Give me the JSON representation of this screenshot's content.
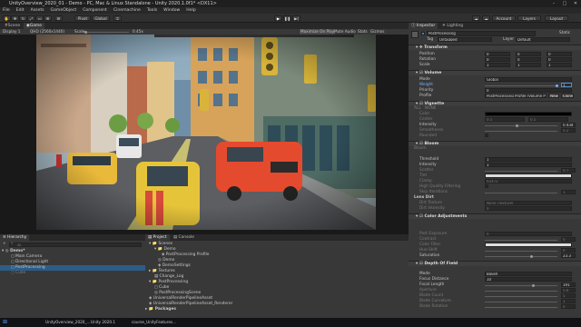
{
  "window": {
    "title": "UnityOverview_2020_01 - Demo - PC, Mac & Linux Standalone - Unity 2020.1.0f1* <DX11>"
  },
  "menu": [
    "File",
    "Edit",
    "Assets",
    "GameObject",
    "Component",
    "Cinemachine",
    "Tools",
    "Window",
    "Help"
  ],
  "toolbar": {
    "pivot": "Pivot",
    "global": "Global",
    "account": "Account",
    "layers": "Layers",
    "layout": "Layout"
  },
  "game": {
    "tabs": {
      "scene": "Scene",
      "game": "Game"
    },
    "display": "Display 1",
    "resolution": "QHD (2560x1440)",
    "scale_label": "Scale",
    "scale_value": "0.45x",
    "maximize": "Maximize On Play",
    "mute": "Mute Audio",
    "stats": "Stats",
    "gizmos": "Gizmos"
  },
  "hierarchy": {
    "tab": "Hierarchy",
    "add": "+",
    "search_placeholder": "All",
    "items": [
      {
        "label": "Demo*",
        "dim": false,
        "bold": true
      },
      {
        "label": "Main Camera",
        "dim": false,
        "bold": false
      },
      {
        "label": "Directional Light",
        "dim": false,
        "bold": false
      },
      {
        "label": "PostProcessing",
        "dim": false,
        "bold": false
      },
      {
        "label": "Cube",
        "dim": true,
        "bold": false
      }
    ]
  },
  "project": {
    "tab": "Project",
    "tab2": "Console",
    "items": [
      "Scenes",
      "Demo",
      "PostProcessing Profile",
      "Demo",
      "DemoSettings",
      "Textures",
      "Change_Log",
      "PostProcessing",
      "Cube",
      "PostProcessingScene",
      "UniversalRenderPipelineAsset",
      "UniversalRenderPipelineAsset_Renderer",
      "Packages"
    ]
  },
  "inspector": {
    "tab": "Inspector",
    "tab2": "Lighting",
    "object_name": "PostProcessing",
    "static": "Static",
    "tag_label": "Tag",
    "tag": "Untagged",
    "layer_label": "Layer",
    "layer": "Default",
    "transform": {
      "title": "Transform",
      "position": "Position",
      "rotation": "Rotation",
      "scale": "Scale",
      "pos": [
        "0",
        "0",
        "0"
      ],
      "rot": [
        "0",
        "0",
        "0"
      ],
      "scl": [
        "1",
        "1",
        "1"
      ]
    },
    "volume": {
      "title": "Volume",
      "mode_label": "Mode",
      "mode": "Global",
      "weight_label": "Weight",
      "weight": "1",
      "priority_label": "Priority",
      "priority": "0",
      "profile_label": "Profile",
      "profile": "PostProcessing Profile (Volume Profile)",
      "new": "New",
      "clone": "Clone"
    },
    "vignette": {
      "title": "Vignette",
      "all": "ALL",
      "none": "NONE",
      "color": "Color",
      "center": "Center",
      "center_x": "0.5",
      "center_y": "0.5",
      "intensity": "Intensity",
      "intensity_value": "0.434",
      "smoothness": "Smoothness",
      "smoothness_value": "0.2",
      "rounded": "Rounded"
    },
    "bloom": {
      "title": "Bloom",
      "section": "Bloom",
      "threshold": "Threshold",
      "threshold_value": "1",
      "intensity": "Intensity",
      "intensity_value": "1",
      "scatter": "Scatter",
      "scatter_value": "0.7",
      "tint": "Tint",
      "clamp": "Clamp",
      "clamp_value": "65472",
      "hq": "High Quality Filtering",
      "skip": "Skip Iterations",
      "skip_value": "1",
      "lens_dirt": "Lens Dirt",
      "dirt_texture": "Dirt Texture",
      "dirt_texture_value": "None (Texture)",
      "dirt_intensity": "Dirt Intensity",
      "dirt_intensity_value": "0"
    },
    "color_adj": {
      "title": "Color Adjustments",
      "post_exposure": "Post Exposure",
      "post_exposure_value": "0",
      "contrast": "Contrast",
      "contrast_value": "0",
      "color_filter": "Color Filter",
      "hue_shift": "Hue Shift",
      "hue_shift_value": "0",
      "saturation": "Saturation",
      "saturation_value": "23.3"
    },
    "dof": {
      "title": "Depth Of Field",
      "mode": "Mode",
      "mode_value": "Bokeh",
      "focus": "Focus Distance",
      "focus_value": "10",
      "focal": "Focal Length",
      "focal_value": "191",
      "aperture": "Aperture",
      "aperture_value": "5.6",
      "blade_count": "Blade Count",
      "blade_count_value": "5",
      "blade_curv": "Blade Curvature",
      "blade_curv_value": "1",
      "blade_rot": "Blade Rotation",
      "blade_rot_value": "0"
    }
  },
  "taskbar": {
    "items": [
      "UnityOverview_2020_...",
      "Unity 2020.1",
      "course_UnityFeatures..."
    ]
  }
}
